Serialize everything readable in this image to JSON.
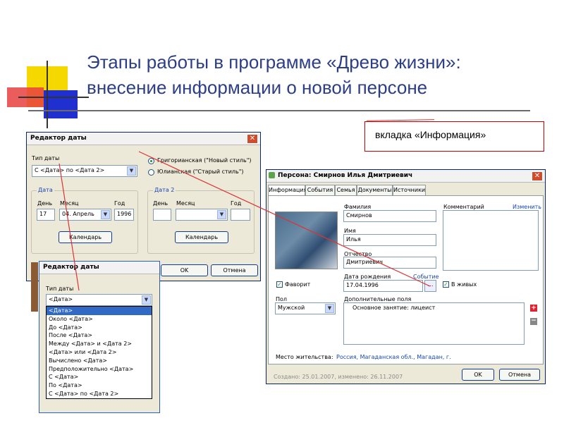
{
  "slide": {
    "title_line1": "Этапы работы в программе «Древо жизни»:",
    "title_line2": "внесение информации о новой персоне",
    "callout": "вкладка «Информация»"
  },
  "date_editor": {
    "title": "Редактор даты",
    "type_label": "Тип даты",
    "type_value": "С <Дата> по <Дата 2>",
    "radio_gregorian": "Григорианская (\"Новый стиль\")",
    "radio_julian": "Юлианская (\"Старый стиль\")",
    "date1_group": "Дата",
    "date2_group": "Дата 2",
    "day_label": "День",
    "month_label": "Месяц",
    "year_label": "Год",
    "day_value": "17",
    "month_value": "04. Апрель",
    "year_value": "1996",
    "calendar_button": "Календарь",
    "calendar_button2": "Календарь",
    "ok": "OK",
    "cancel": "Отмена"
  },
  "date_editor2": {
    "title": "Редактор даты",
    "type_label": "Тип даты",
    "select_value": "<Дата>",
    "options": [
      "<Дата>",
      "Около <Дата>",
      "До <Дата>",
      "После <Дата>",
      "Между <Дата> и <Дата 2>",
      "<Дата> или <Дата 2>",
      "Вычислено <Дата>",
      "Предположительно <Дата>",
      "С <Дата>",
      "По <Дата>",
      "С <Дата> по <Дата 2>"
    ],
    "selected_index": 0
  },
  "person": {
    "title": "Персона: Смирнов Илья Дмитриевич",
    "tabs": [
      "Информация",
      "События",
      "Семья",
      "Документы",
      "Источники"
    ],
    "active_tab": 0,
    "surname_label": "Фамилия",
    "surname": "Смирнов",
    "name_label": "Имя",
    "name": "Илья",
    "patronymic_label": "Отчество",
    "patronymic": "Дмитриевич",
    "birth_label": "Дата рождения",
    "event_link": "Событие",
    "birth_date": "17.04.1996",
    "comment_label": "Комментарий",
    "edit_link": "Изменить",
    "favorite_label": "Фаворит",
    "alive_label": "В живых",
    "sex_label": "Пол",
    "sex_value": "Мужской",
    "extra_label": "Дополнительные поля",
    "extra_value": "Основное занятие:  лицеист",
    "residence_label": "Место жительства:",
    "residence_value": "Россия, Магаданская обл., Магадан, г.",
    "footer": "Создано: 25.01.2007, изменено: 26.11.2007",
    "ok": "OK",
    "cancel": "Отмена"
  },
  "colors": {
    "title_blue": "#2c3e88",
    "accent_red": "#c00000",
    "square_yellow": "#f5d800",
    "square_blue": "#1f2fd0",
    "square_red": "#e84040"
  }
}
